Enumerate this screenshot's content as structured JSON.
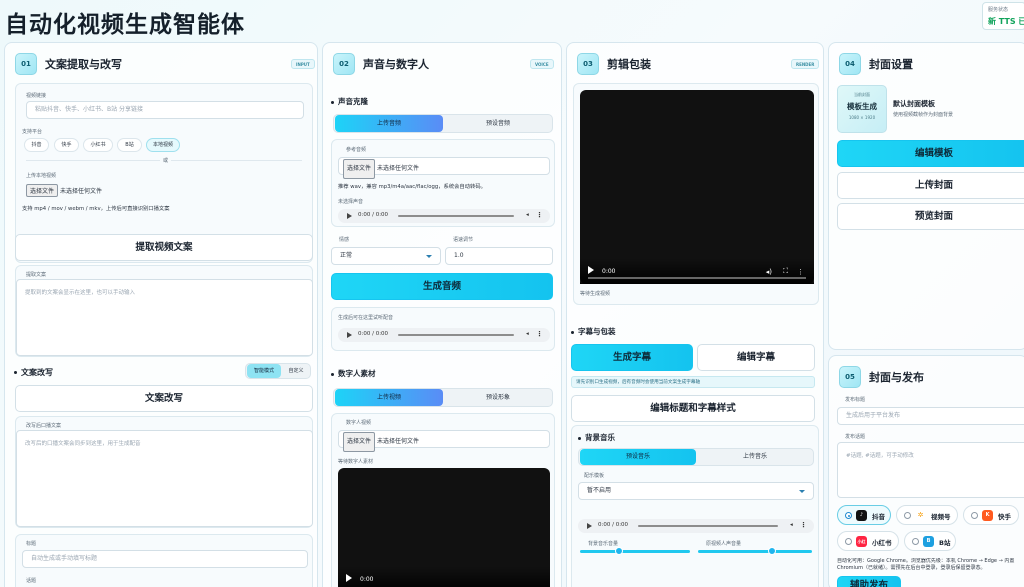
{
  "app": {
    "title": "自动化视频生成智能体",
    "service_label": "服务状态",
    "service_status": "新 TTS 已"
  },
  "col1": {
    "num": "01",
    "title": "文案提取与改写",
    "tag": "INPUT",
    "link_label": "视频链接",
    "link_placeholder": "粘贴抖音、快手、小红书、B站 分享链接",
    "platform_label": "支持平台",
    "platforms": [
      "抖音",
      "快手",
      "小红书",
      "B站",
      "本地视频"
    ],
    "or": "或",
    "upload_label": "上传本地视频",
    "file_btn": "选择文件",
    "file_none": "未选择任何文件",
    "upload_hint": "支持 mp4 / mov / webm / mkv，上传后可直接识别口播文案",
    "extract_btn": "提取视频文案",
    "extracted_label": "提取文案",
    "extracted_placeholder": "提取到的文案会显示在这里，也可以手动输入",
    "rewrite_title": "文案改写",
    "mode_smart": "智能模式",
    "mode_custom": "自定义",
    "rewrite_btn": "文案改写",
    "rewritten_label": "改写后口播文案",
    "rewritten_placeholder": "改写后的口播文案会同步到这里，用于生成配音",
    "title_label": "标题",
    "title_placeholder": "自动生成或手动填写标题",
    "topic_label": "话题"
  },
  "col2": {
    "num": "02",
    "title": "声音与数字人",
    "tag": "VOICE",
    "voice_section": "声音克隆",
    "tab_upload": "上传音频",
    "tab_preset": "预设音频",
    "ref_label": "参考音频",
    "file_btn": "选择文件",
    "file_none": "未选择任何文件",
    "ref_hint": "推荐 wav，兼容 mp3/m4a/aac/flac/ogg，系统会自动转码。",
    "not_selected": "未选择声音",
    "audio_time": "0:00 / 0:00",
    "mood_label": "情感",
    "mood_value": "正常",
    "speed_label": "语速调节",
    "speed_value": "1.0",
    "gen_btn": "生成音频",
    "gen_hint": "生成后可在这里试听配音",
    "audio_time2": "0:00 / 0:00",
    "avatar_section": "数字人素材",
    "tab_upload_video": "上传视频",
    "tab_preset_avatar": "预设形象",
    "avatar_label": "数字人视频",
    "avatar_preview": "等待数字人素材",
    "video_time": "0:00"
  },
  "col3": {
    "num": "03",
    "title": "剪辑包装",
    "tag": "RENDER",
    "video_time": "0:00",
    "video_caption": "等待生成视频",
    "sub_section": "字幕与包装",
    "gen_sub_btn": "生成字幕",
    "edit_sub_btn": "编辑字幕",
    "sub_hint": "请先识别口生成视频，后有音频时会使用当前文案生成字幕轴",
    "style_btn": "编辑标题和字幕样式",
    "bgm_section": "背景音乐",
    "tab_preset_music": "预设音乐",
    "tab_upload_music": "上传音乐",
    "bgm_label": "配乐模板",
    "bgm_value": "暂不启用",
    "audio_time": "0:00 / 0:00",
    "bgm_vol_label": "背景音乐音量",
    "voice_vol_label": "原视频人声音量",
    "bgm_vol": 0.35,
    "voice_vol": 0.65
  },
  "col4": {
    "num": "04",
    "title": "封面设置",
    "thumb_top": "当前封面",
    "thumb_mid": "模板生成",
    "thumb_bot": "1080 × 1920",
    "tpl_name": "默认封面模板",
    "tpl_desc": "使用视频截帧作为封面背景",
    "edit_tpl_btn": "编辑模板",
    "upload_cover_btn": "上传封面",
    "preview_cover_btn": "预览封面"
  },
  "col5": {
    "num": "05",
    "title": "封面与发布",
    "pub_title_label": "发布标题",
    "pub_title_placeholder": "生成后用于平台发布",
    "pub_topic_label": "发布话题",
    "pub_topic_placeholder": "#话题, #话题，可手动修改",
    "platforms": [
      {
        "name": "抖音",
        "on": true,
        "icon": "douyin-icon",
        "color": "#111111"
      },
      {
        "name": "视频号",
        "on": false,
        "icon": "wechat-channels-icon",
        "color": "#f7a51c"
      },
      {
        "name": "快手",
        "on": false,
        "icon": "kuaishou-icon",
        "color": "#ff5a1f"
      },
      {
        "name": "小红书",
        "on": false,
        "icon": "xiaohongshu-icon",
        "color": "#ff2442"
      },
      {
        "name": "B站",
        "on": false,
        "icon": "bilibili-icon",
        "color": "#1ea0e0"
      }
    ],
    "auto_note": "自动化可用：Google Chrome。浏览器优先级：本机 Chrome → Edge → 内置 Chromium（已就绪）。需预先在后台中登录，登录后保留登录态。",
    "publish_btn": "辅助发布"
  }
}
